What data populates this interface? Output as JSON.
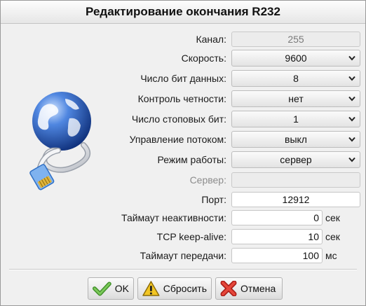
{
  "dialog": {
    "title": "Редактирование окончания R232",
    "icon": "globe-network-cable-icon"
  },
  "fields": {
    "channel": {
      "label": "Канал:",
      "value": "255"
    },
    "speed": {
      "label": "Скорость:",
      "value": "9600"
    },
    "data_bits": {
      "label": "Число бит данных:",
      "value": "8"
    },
    "parity": {
      "label": "Контроль четности:",
      "value": "нет"
    },
    "stop_bits": {
      "label": "Число стоповых бит:",
      "value": "1"
    },
    "flow_control": {
      "label": "Управление потоком:",
      "value": "выкл"
    },
    "mode": {
      "label": "Режим работы:",
      "value": "сервер"
    },
    "server": {
      "label": "Сервер:",
      "value": ""
    },
    "port": {
      "label": "Порт:",
      "value": "12912"
    },
    "idle_timeout": {
      "label": "Таймаут неактивности:",
      "value": "0",
      "unit": "сек"
    },
    "tcp_keepalive": {
      "label": "TCP keep-alive:",
      "value": "10",
      "unit": "сек"
    },
    "send_timeout": {
      "label": "Таймаут передачи:",
      "value": "100",
      "unit": "мс"
    }
  },
  "buttons": {
    "ok": {
      "label": "OK",
      "icon": "check-icon"
    },
    "reset": {
      "label": "Сбросить",
      "icon": "warning-icon"
    },
    "cancel": {
      "label": "Отмена",
      "icon": "x-icon"
    }
  },
  "colors": {
    "ok_icon": "#5aa83a",
    "reset_icon": "#f0c419",
    "cancel_icon": "#d9342b",
    "globe": "#2a5bb8"
  }
}
